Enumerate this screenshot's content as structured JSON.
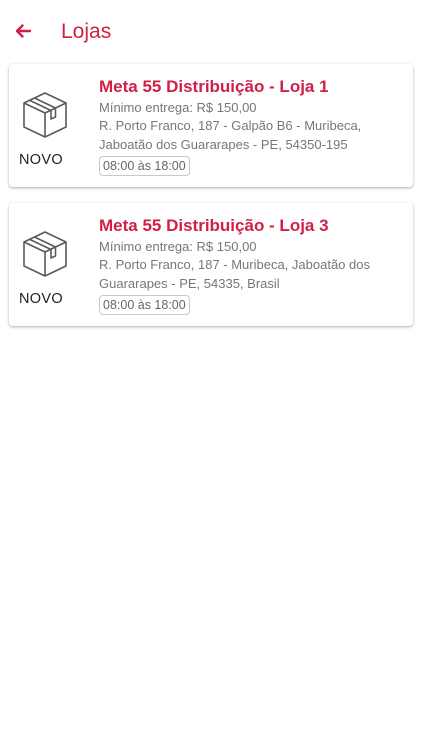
{
  "header": {
    "title": "Lojas",
    "back_icon": "arrow-left-icon",
    "accent_color": "#d11f47"
  },
  "stores": [
    {
      "name": "Meta 55 Distribuição - Loja 1",
      "min_order": "Mínimo entrega: R$ 150,00",
      "address": "R. Porto Franco, 187 - Galpão B6 - Muribeca, Jaboatão dos Guararapes - PE, 54350-195",
      "hours": "08:00 às 18:00",
      "badge": "NOVO",
      "icon": "box-icon"
    },
    {
      "name": "Meta 55 Distribuição - Loja 3",
      "min_order": "Mínimo entrega: R$ 150,00",
      "address": "R. Porto Franco, 187 - Muribeca, Jaboatão dos Guararapes - PE, 54335, Brasil",
      "hours": "08:00 às 18:00",
      "badge": "NOVO",
      "icon": "box-icon"
    }
  ]
}
